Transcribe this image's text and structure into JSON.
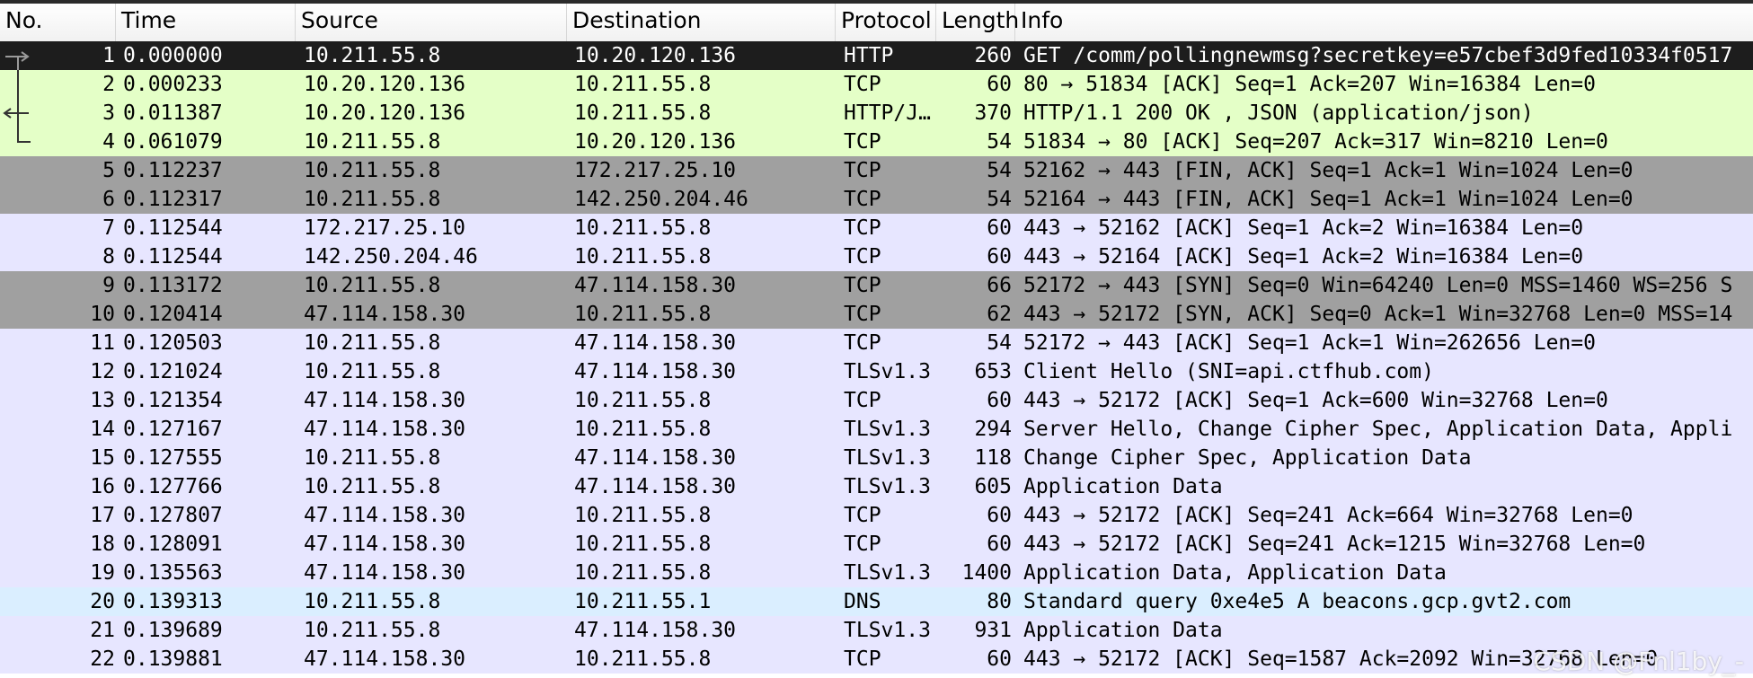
{
  "header": {
    "no": "No.",
    "time": "Time",
    "source": "Source",
    "destination": "Destination",
    "protocol": "Protocol",
    "length": "Length",
    "info": "Info"
  },
  "colors": {
    "selected": "#1d1d1d",
    "http": "#e4ffc7",
    "tcp_dark": "#a0a0a0",
    "tcp": "#e7e6ff",
    "dns": "#daeeff"
  },
  "packets": [
    {
      "no": "1",
      "time": "0.000000",
      "source": "10.211.55.8",
      "destination": "10.20.120.136",
      "protocol": "HTTP",
      "length": "260",
      "info": "GET /comm/pollingnewmsg?secretkey=e57cbef3d9fed10334f0517",
      "row_style": "selected",
      "marker": "request"
    },
    {
      "no": "2",
      "time": "0.000233",
      "source": "10.20.120.136",
      "destination": "10.211.55.8",
      "protocol": "TCP",
      "length": "60",
      "info": "80 → 51834 [ACK] Seq=1 Ack=207 Win=16384 Len=0",
      "row_style": "http",
      "marker": "line"
    },
    {
      "no": "3",
      "time": "0.011387",
      "source": "10.20.120.136",
      "destination": "10.211.55.8",
      "protocol": "HTTP/J…",
      "length": "370",
      "info": "HTTP/1.1 200 OK , JSON (application/json)",
      "row_style": "http",
      "marker": "response"
    },
    {
      "no": "4",
      "time": "0.061079",
      "source": "10.211.55.8",
      "destination": "10.20.120.136",
      "protocol": "TCP",
      "length": "54",
      "info": "51834 → 80 [ACK] Seq=207 Ack=317 Win=8210 Len=0",
      "row_style": "http",
      "marker": "end"
    },
    {
      "no": "5",
      "time": "0.112237",
      "source": "10.211.55.8",
      "destination": "172.217.25.10",
      "protocol": "TCP",
      "length": "54",
      "info": "52162 → 443 [FIN, ACK] Seq=1 Ack=1 Win=1024 Len=0",
      "row_style": "tcp_dark",
      "marker": ""
    },
    {
      "no": "6",
      "time": "0.112317",
      "source": "10.211.55.8",
      "destination": "142.250.204.46",
      "protocol": "TCP",
      "length": "54",
      "info": "52164 → 443 [FIN, ACK] Seq=1 Ack=1 Win=1024 Len=0",
      "row_style": "tcp_dark",
      "marker": ""
    },
    {
      "no": "7",
      "time": "0.112544",
      "source": "172.217.25.10",
      "destination": "10.211.55.8",
      "protocol": "TCP",
      "length": "60",
      "info": "443 → 52162 [ACK] Seq=1 Ack=2 Win=16384 Len=0",
      "row_style": "tcp",
      "marker": ""
    },
    {
      "no": "8",
      "time": "0.112544",
      "source": "142.250.204.46",
      "destination": "10.211.55.8",
      "protocol": "TCP",
      "length": "60",
      "info": "443 → 52164 [ACK] Seq=1 Ack=2 Win=16384 Len=0",
      "row_style": "tcp",
      "marker": ""
    },
    {
      "no": "9",
      "time": "0.113172",
      "source": "10.211.55.8",
      "destination": "47.114.158.30",
      "protocol": "TCP",
      "length": "66",
      "info": "52172 → 443 [SYN] Seq=0 Win=64240 Len=0 MSS=1460 WS=256 S",
      "row_style": "tcp_dark",
      "marker": ""
    },
    {
      "no": "10",
      "time": "0.120414",
      "source": "47.114.158.30",
      "destination": "10.211.55.8",
      "protocol": "TCP",
      "length": "62",
      "info": "443 → 52172 [SYN, ACK] Seq=0 Ack=1 Win=32768 Len=0 MSS=14",
      "row_style": "tcp_dark",
      "marker": ""
    },
    {
      "no": "11",
      "time": "0.120503",
      "source": "10.211.55.8",
      "destination": "47.114.158.30",
      "protocol": "TCP",
      "length": "54",
      "info": "52172 → 443 [ACK] Seq=1 Ack=1 Win=262656 Len=0",
      "row_style": "tcp",
      "marker": ""
    },
    {
      "no": "12",
      "time": "0.121024",
      "source": "10.211.55.8",
      "destination": "47.114.158.30",
      "protocol": "TLSv1.3",
      "length": "653",
      "info": "Client Hello (SNI=api.ctfhub.com)",
      "row_style": "tcp",
      "marker": ""
    },
    {
      "no": "13",
      "time": "0.121354",
      "source": "47.114.158.30",
      "destination": "10.211.55.8",
      "protocol": "TCP",
      "length": "60",
      "info": "443 → 52172 [ACK] Seq=1 Ack=600 Win=32768 Len=0",
      "row_style": "tcp",
      "marker": ""
    },
    {
      "no": "14",
      "time": "0.127167",
      "source": "47.114.158.30",
      "destination": "10.211.55.8",
      "protocol": "TLSv1.3",
      "length": "294",
      "info": "Server Hello, Change Cipher Spec, Application Data, Appli",
      "row_style": "tcp",
      "marker": ""
    },
    {
      "no": "15",
      "time": "0.127555",
      "source": "10.211.55.8",
      "destination": "47.114.158.30",
      "protocol": "TLSv1.3",
      "length": "118",
      "info": "Change Cipher Spec, Application Data",
      "row_style": "tcp",
      "marker": ""
    },
    {
      "no": "16",
      "time": "0.127766",
      "source": "10.211.55.8",
      "destination": "47.114.158.30",
      "protocol": "TLSv1.3",
      "length": "605",
      "info": "Application Data",
      "row_style": "tcp",
      "marker": ""
    },
    {
      "no": "17",
      "time": "0.127807",
      "source": "47.114.158.30",
      "destination": "10.211.55.8",
      "protocol": "TCP",
      "length": "60",
      "info": "443 → 52172 [ACK] Seq=241 Ack=664 Win=32768 Len=0",
      "row_style": "tcp",
      "marker": ""
    },
    {
      "no": "18",
      "time": "0.128091",
      "source": "47.114.158.30",
      "destination": "10.211.55.8",
      "protocol": "TCP",
      "length": "60",
      "info": "443 → 52172 [ACK] Seq=241 Ack=1215 Win=32768 Len=0",
      "row_style": "tcp",
      "marker": ""
    },
    {
      "no": "19",
      "time": "0.135563",
      "source": "47.114.158.30",
      "destination": "10.211.55.8",
      "protocol": "TLSv1.3",
      "length": "1400",
      "info": "Application Data, Application Data",
      "row_style": "tcp",
      "marker": ""
    },
    {
      "no": "20",
      "time": "0.139313",
      "source": "10.211.55.8",
      "destination": "10.211.55.1",
      "protocol": "DNS",
      "length": "80",
      "info": "Standard query 0xe4e5 A beacons.gcp.gvt2.com",
      "row_style": "dns",
      "marker": ""
    },
    {
      "no": "21",
      "time": "0.139689",
      "source": "10.211.55.8",
      "destination": "47.114.158.30",
      "protocol": "TLSv1.3",
      "length": "931",
      "info": "Application Data",
      "row_style": "tcp",
      "marker": ""
    },
    {
      "no": "22",
      "time": "0.139881",
      "source": "47.114.158.30",
      "destination": "10.211.55.8",
      "protocol": "TCP",
      "length": "60",
      "info": "443 → 52172 [ACK] Seq=1587 Ack=2092 Win=32768 Len=0",
      "row_style": "tcp",
      "marker": ""
    }
  ],
  "watermark": "CSDN @Fnl1by_-"
}
